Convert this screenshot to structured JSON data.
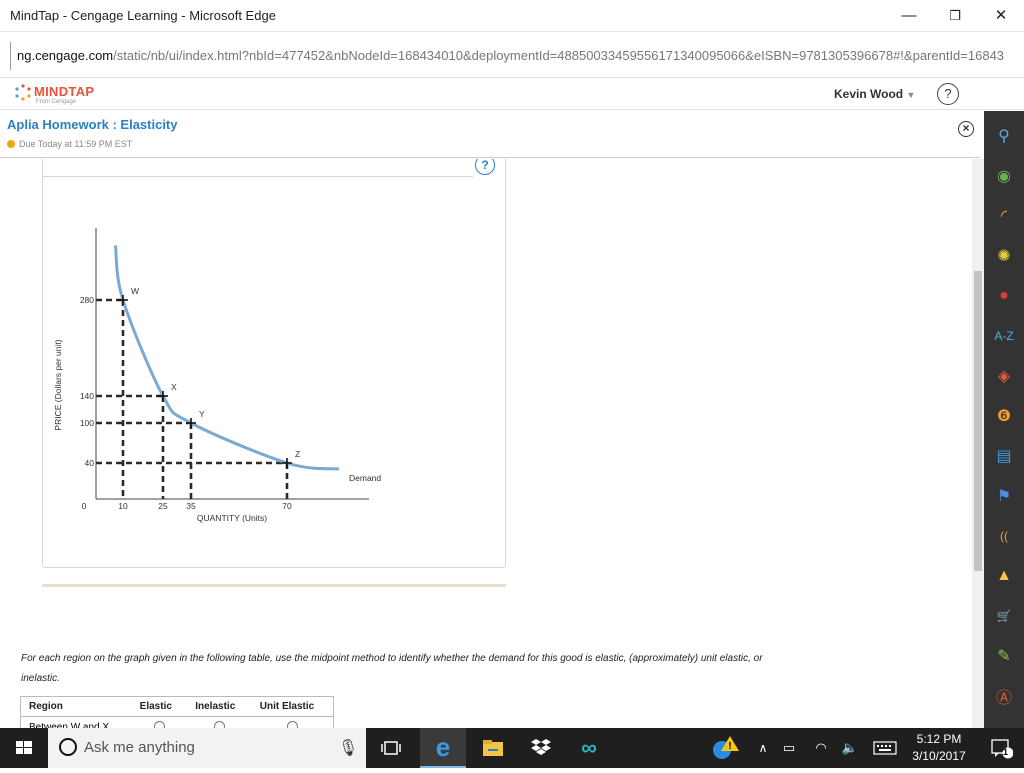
{
  "window": {
    "title": "MindTap - Cengage Learning - Microsoft Edge",
    "minimize": "—",
    "restore": "❐",
    "close": "✕"
  },
  "address": {
    "host": "ng.cengage.com",
    "path": "/static/nb/ui/index.html?nbId=477452&nbNodeId=168434010&deploymentId=48850033459556171340095066&eISBN=9781305396678#!&parentId=16843"
  },
  "mindtap": {
    "brand": "MINDTAP",
    "sub": "From Cengage",
    "user": "Kevin Wood",
    "help": "?"
  },
  "activity": {
    "title": "Aplia Homework : Elasticity",
    "due": "Due Today at 11:59 PM EST",
    "close": "×"
  },
  "graph": {
    "help": "?",
    "ylabel": "PRICE (Dollars per unit)",
    "xlabel": "QUANTITY (Units)",
    "curve_label": "Demand"
  },
  "chart_data": {
    "type": "line",
    "title": "",
    "xlabel": "QUANTITY (Units)",
    "ylabel": "PRICE (Dollars per unit)",
    "x_ticks": [
      0,
      10,
      25,
      35,
      70
    ],
    "y_ticks": [
      40,
      100,
      140,
      280
    ],
    "series": [
      {
        "name": "Demand",
        "points": [
          {
            "label": "W",
            "x": 10,
            "y": 280
          },
          {
            "label": "X",
            "x": 25,
            "y": 140
          },
          {
            "label": "Y",
            "x": 35,
            "y": 100
          },
          {
            "label": "Z",
            "x": 70,
            "y": 40
          }
        ]
      }
    ],
    "grid": false,
    "legend": "none"
  },
  "instructions": "For each region on the graph given in the following table, use the midpoint method to identify whether the demand for this good is elastic, (approximately) unit elastic, or inelastic.",
  "table": {
    "headers": [
      "Region",
      "Elastic",
      "Inelastic",
      "Unit Elastic"
    ],
    "rows": [
      {
        "region": "Between W and X"
      }
    ]
  },
  "taskbar": {
    "search": "Ask me anything",
    "time": "5:12 PM",
    "date": "3/10/2017",
    "notifications": "1"
  },
  "dock": [
    "search-icon",
    "profile-icon",
    "rss-icon",
    "flower-icon",
    "merriam-webster-icon",
    "a-z-icon",
    "cy-icon",
    "bookmark-icon",
    "notes-icon",
    "flag-icon",
    "audio-icon",
    "drive-icon",
    "cart-icon",
    "edit-icon",
    "mt-icon"
  ]
}
